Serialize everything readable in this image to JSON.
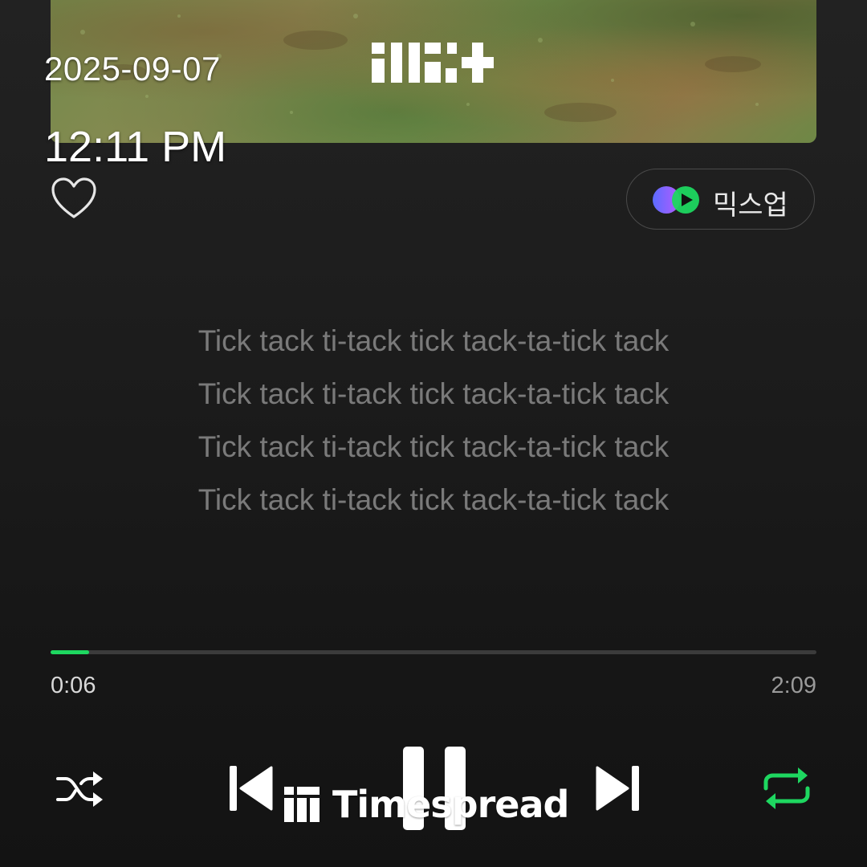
{
  "status_bar": {
    "date": "2025-09-07",
    "time": "12:11 PM"
  },
  "album": {
    "logo_icon": "artist-logo-glyph"
  },
  "actions": {
    "like_icon": "heart-outline-icon",
    "mixup_label": "믹스업",
    "mixup_icon": "mixup-icon"
  },
  "lyrics": [
    "Tick tack ti-tack tick tack-ta-tick tack",
    "Tick tack ti-tack tick tack-ta-tick tack",
    "Tick tack ti-tack tick tack-ta-tick tack",
    "Tick tack ti-tack tick tack-ta-tick tack"
  ],
  "playback": {
    "elapsed": "0:06",
    "total": "2:09",
    "progress_fraction": 0.05
  },
  "controls": {
    "shuffle_icon": "shuffle-icon",
    "previous_icon": "skip-previous-icon",
    "play_state_icon": "pause-icon",
    "next_icon": "skip-next-icon",
    "repeat_icon": "repeat-icon",
    "repeat_active": true
  },
  "watermark": {
    "text": "Timespread",
    "icon": "timespread-logo-icon"
  },
  "colors": {
    "accent": "#1ed760",
    "lyric": "#7a7a7a",
    "background": "#1b1b1b"
  }
}
